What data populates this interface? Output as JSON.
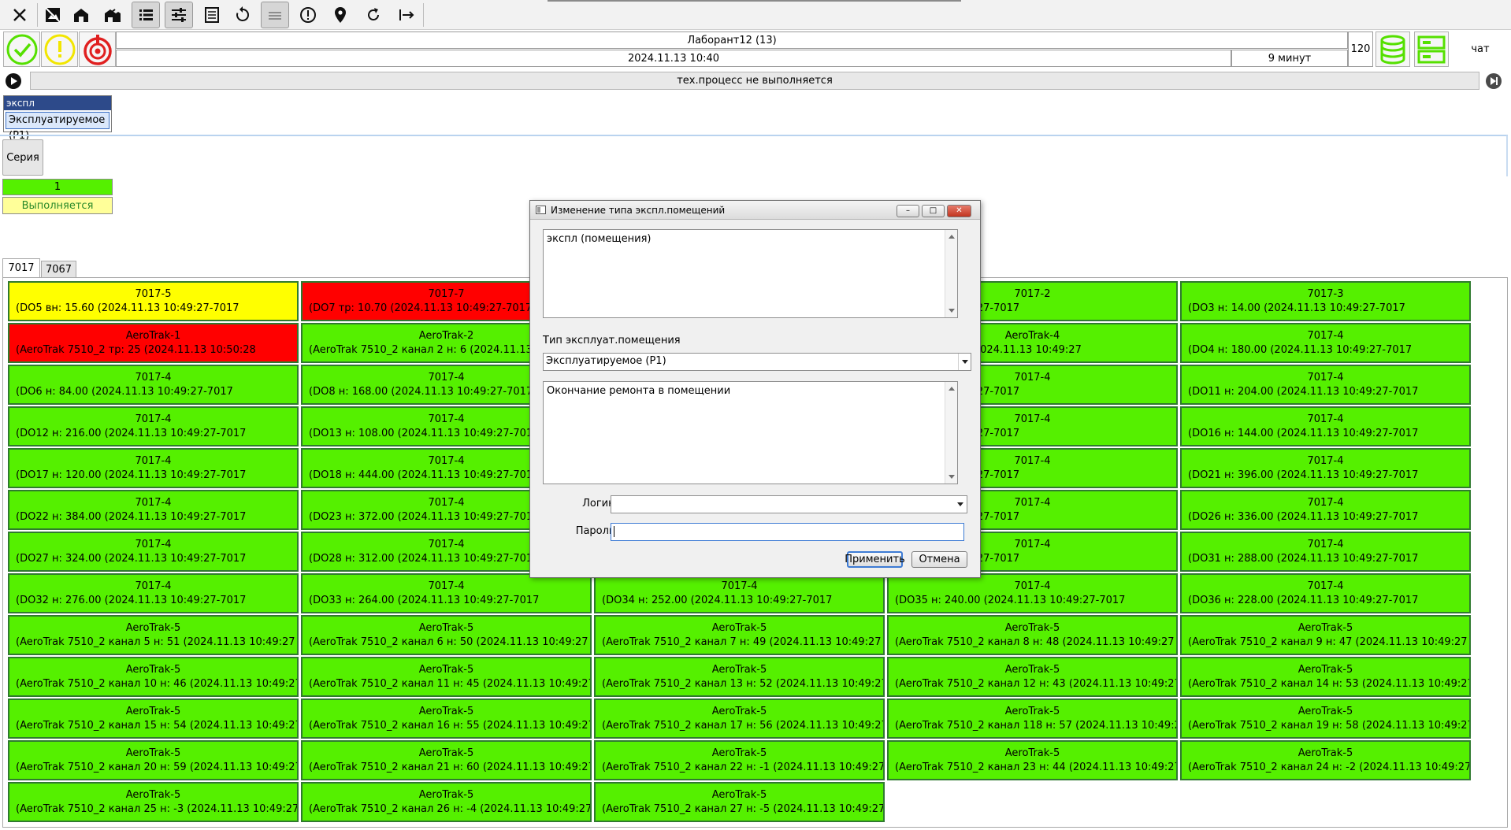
{
  "toolbar": {
    "icons": [
      "close-icon",
      "no-image-icon",
      "building-icon",
      "buildings-icon",
      "list-icon",
      "sliders-icon",
      "table-icon",
      "reset-icon",
      "text-lines-icon",
      "alert-icon",
      "map-pin-icon",
      "refresh-icon",
      "logout-icon"
    ]
  },
  "header": {
    "user": "Лаборант12 (13)",
    "datetime": "2024.11.13  10:40",
    "duration": "9 минут",
    "counter": "120",
    "chat": "чат"
  },
  "status_colors": {
    "ok": "#55f000",
    "warn": "#ffff00",
    "alarm": "#ff0000"
  },
  "process": {
    "status": "тех.процесс не выполняется"
  },
  "expl": {
    "title": "экспл",
    "value": "Эксплуатируемое (P1)"
  },
  "series": {
    "label": "Серия",
    "number": "1",
    "status": "Выполняется"
  },
  "tabs": [
    {
      "label": "7017"
    },
    {
      "label": "7067"
    }
  ],
  "tiles": [
    {
      "title": "7017-5",
      "detail": "(DO5 вн: 15.60 (2024.11.13 10:49:27-7017",
      "status": "warn"
    },
    {
      "title": "7017-7",
      "detail": "(DO7 тр: 10.70 (2024.11.13 10:49:27-7017",
      "status": "alarm"
    },
    {
      "title": "",
      "detail": "",
      "status": "ok"
    },
    {
      "title": "7017-2",
      "detail": "24.11.13 10:49:27-7017",
      "status": "ok"
    },
    {
      "title": "7017-3",
      "detail": "(DO3 н: 14.00 (2024.11.13 10:49:27-7017",
      "status": "ok"
    },
    {
      "title": "AeroTrak-1",
      "detail": "(AeroTrak 7510_2 тр: 25 (2024.11.13 10:50:28",
      "status": "alarm"
    },
    {
      "title": "AeroTrak-2",
      "detail": "(AeroTrak 7510_2 канал 2 н: 6 (2024.11.13 10:4",
      "status": "ok"
    },
    {
      "title": "",
      "detail": "",
      "status": "ok"
    },
    {
      "title": "AeroTrak-4",
      "detail": "канал 4 н: 11 (2024.11.13 10:49:27",
      "status": "ok"
    },
    {
      "title": "7017-4",
      "detail": "(DO4 н: 180.00 (2024.11.13 10:49:27-7017",
      "status": "ok"
    },
    {
      "title": "7017-4",
      "detail": "(DO6 н: 84.00 (2024.11.13 10:49:27-7017",
      "status": "ok"
    },
    {
      "title": "7017-4",
      "detail": "(DO8 н: 168.00 (2024.11.13 10:49:27-7017",
      "status": "ok"
    },
    {
      "title": "",
      "detail": "",
      "status": "ok"
    },
    {
      "title": "7017-4",
      "detail": "24.11.13 10:49:27-7017",
      "status": "ok"
    },
    {
      "title": "7017-4",
      "detail": "(DO11 н: 204.00 (2024.11.13 10:49:27-7017",
      "status": "ok"
    },
    {
      "title": "7017-4",
      "detail": "(DO12 н: 216.00 (2024.11.13 10:49:27-7017",
      "status": "ok"
    },
    {
      "title": "7017-4",
      "detail": "(DO13 н: 108.00 (2024.11.13 10:49:27-7017",
      "status": "ok"
    },
    {
      "title": "",
      "detail": "",
      "status": "ok"
    },
    {
      "title": "7017-4",
      "detail": "24.11.13 10:49:27-7017",
      "status": "ok"
    },
    {
      "title": "7017-4",
      "detail": "(DO16 н: 144.00 (2024.11.13 10:49:27-7017",
      "status": "ok"
    },
    {
      "title": "7017-4",
      "detail": "(DO17 н: 120.00 (2024.11.13 10:49:27-7017",
      "status": "ok"
    },
    {
      "title": "7017-4",
      "detail": "(DO18 н: 444.00 (2024.11.13 10:49:27-7017",
      "status": "ok"
    },
    {
      "title": "",
      "detail": "",
      "status": "ok"
    },
    {
      "title": "7017-4",
      "detail": "24.11.13 10:49:27-7017",
      "status": "ok"
    },
    {
      "title": "7017-4",
      "detail": "(DO21 н: 396.00 (2024.11.13 10:49:27-7017",
      "status": "ok"
    },
    {
      "title": "7017-4",
      "detail": "(DO22 н: 384.00 (2024.11.13 10:49:27-7017",
      "status": "ok"
    },
    {
      "title": "7017-4",
      "detail": "(DO23 н: 372.00 (2024.11.13 10:49:27-7017",
      "status": "ok"
    },
    {
      "title": "",
      "detail": "",
      "status": "ok"
    },
    {
      "title": "7017-4",
      "detail": "24.11.13 10:49:27-7017",
      "status": "ok"
    },
    {
      "title": "7017-4",
      "detail": "(DO26 н: 336.00 (2024.11.13 10:49:27-7017",
      "status": "ok"
    },
    {
      "title": "7017-4",
      "detail": "(DO27 н: 324.00 (2024.11.13 10:49:27-7017",
      "status": "ok"
    },
    {
      "title": "7017-4",
      "detail": "(DO28 н: 312.00 (2024.11.13 10:49:27-7017",
      "status": "ok"
    },
    {
      "title": "",
      "detail": "",
      "status": "ok"
    },
    {
      "title": "7017-4",
      "detail": "24.11.13 10:49:27-7017",
      "status": "ok"
    },
    {
      "title": "7017-4",
      "detail": "(DO31 н: 288.00 (2024.11.13 10:49:27-7017",
      "status": "ok"
    },
    {
      "title": "7017-4",
      "detail": "(DO32 н: 276.00 (2024.11.13 10:49:27-7017",
      "status": "ok"
    },
    {
      "title": "7017-4",
      "detail": "(DO33 н: 264.00 (2024.11.13 10:49:27-7017",
      "status": "ok"
    },
    {
      "title": "7017-4",
      "detail": "(DO34 н: 252.00 (2024.11.13 10:49:27-7017",
      "status": "ok"
    },
    {
      "title": "7017-4",
      "detail": "(DO35 н: 240.00 (2024.11.13 10:49:27-7017",
      "status": "ok"
    },
    {
      "title": "7017-4",
      "detail": "(DO36 н: 228.00 (2024.11.13 10:49:27-7017",
      "status": "ok"
    },
    {
      "title": "AeroTrak-5",
      "detail": "(AeroTrak 7510_2 канал 5 н: 51 (2024.11.13 10:49:27",
      "status": "ok"
    },
    {
      "title": "AeroTrak-5",
      "detail": "(AeroTrak 7510_2 канал 6 н: 50 (2024.11.13 10:49:27",
      "status": "ok"
    },
    {
      "title": "AeroTrak-5",
      "detail": "(AeroTrak 7510_2 канал 7 н: 49 (2024.11.13 10:49:27",
      "status": "ok"
    },
    {
      "title": "AeroTrak-5",
      "detail": "(AeroTrak 7510_2 канал 8 н: 48 (2024.11.13 10:49:27",
      "status": "ok"
    },
    {
      "title": "AeroTrak-5",
      "detail": "(AeroTrak 7510_2 канал 9 н: 47 (2024.11.13 10:49:27",
      "status": "ok"
    },
    {
      "title": "AeroTrak-5",
      "detail": "(AeroTrak 7510_2 канал 10 н: 46 (2024.11.13 10:49:27",
      "status": "ok"
    },
    {
      "title": "AeroTrak-5",
      "detail": "(AeroTrak 7510_2 канал 11 н: 45 (2024.11.13 10:49:27",
      "status": "ok"
    },
    {
      "title": "AeroTrak-5",
      "detail": "(AeroTrak 7510_2 канал 13 н: 52 (2024.11.13 10:49:27",
      "status": "ok"
    },
    {
      "title": "AeroTrak-5",
      "detail": "(AeroTrak 7510_2 канал 12 н: 43 (2024.11.13 10:49:27",
      "status": "ok"
    },
    {
      "title": "AeroTrak-5",
      "detail": "(AeroTrak 7510_2 канал 14 н: 53 (2024.11.13 10:49:27",
      "status": "ok"
    },
    {
      "title": "AeroTrak-5",
      "detail": "(AeroTrak 7510_2 канал 15 н: 54 (2024.11.13 10:49:27",
      "status": "ok"
    },
    {
      "title": "AeroTrak-5",
      "detail": "(AeroTrak 7510_2 канал 16 н: 55 (2024.11.13 10:49:27",
      "status": "ok"
    },
    {
      "title": "AeroTrak-5",
      "detail": "(AeroTrak 7510_2 канал 17 н: 56 (2024.11.13 10:49:27",
      "status": "ok"
    },
    {
      "title": "AeroTrak-5",
      "detail": "(AeroTrak 7510_2 канал 118 н: 57 (2024.11.13 10:49:27",
      "status": "ok"
    },
    {
      "title": "AeroTrak-5",
      "detail": "(AeroTrak 7510_2 канал 19 н: 58 (2024.11.13 10:49:27",
      "status": "ok"
    },
    {
      "title": "AeroTrak-5",
      "detail": "(AeroTrak 7510_2 канал 20 н: 59 (2024.11.13 10:49:27",
      "status": "ok"
    },
    {
      "title": "AeroTrak-5",
      "detail": "(AeroTrak 7510_2 канал 21 н: 60 (2024.11.13 10:49:27",
      "status": "ok"
    },
    {
      "title": "AeroTrak-5",
      "detail": "(AeroTrak 7510_2 канал 22 н: -1 (2024.11.13 10:49:27",
      "status": "ok"
    },
    {
      "title": "AeroTrak-5",
      "detail": "(AeroTrak 7510_2 канал 23 н: 44 (2024.11.13 10:49:27",
      "status": "ok"
    },
    {
      "title": "AeroTrak-5",
      "detail": "(AeroTrak 7510_2 канал 24 н: -2 (2024.11.13 10:49:27",
      "status": "ok"
    },
    {
      "title": "AeroTrak-5",
      "detail": "(AeroTrak 7510_2 канал 25 н: -3 (2024.11.13 10:49:27",
      "status": "ok"
    },
    {
      "title": "AeroTrak-5",
      "detail": "(AeroTrak 7510_2 канал 26 н: -4 (2024.11.13 10:49:27",
      "status": "ok"
    },
    {
      "title": "AeroTrak-5",
      "detail": "(AeroTrak 7510_2 канал 27 н: -5 (2024.11.13 10:49:27",
      "status": "ok"
    }
  ],
  "dialog": {
    "title": "Изменение типа экспл.помещений",
    "text1": "экспл (помещения)",
    "type_label": "Тип эксплуат.помещения",
    "type_value": "Эксплуатируемое (P1)",
    "comment": "Окончание ремонта в помещении",
    "login_label": "Логин:",
    "login_value": "",
    "password_label": "Пароль:",
    "password_value": "",
    "apply": "Применить",
    "cancel": "Отмена"
  }
}
